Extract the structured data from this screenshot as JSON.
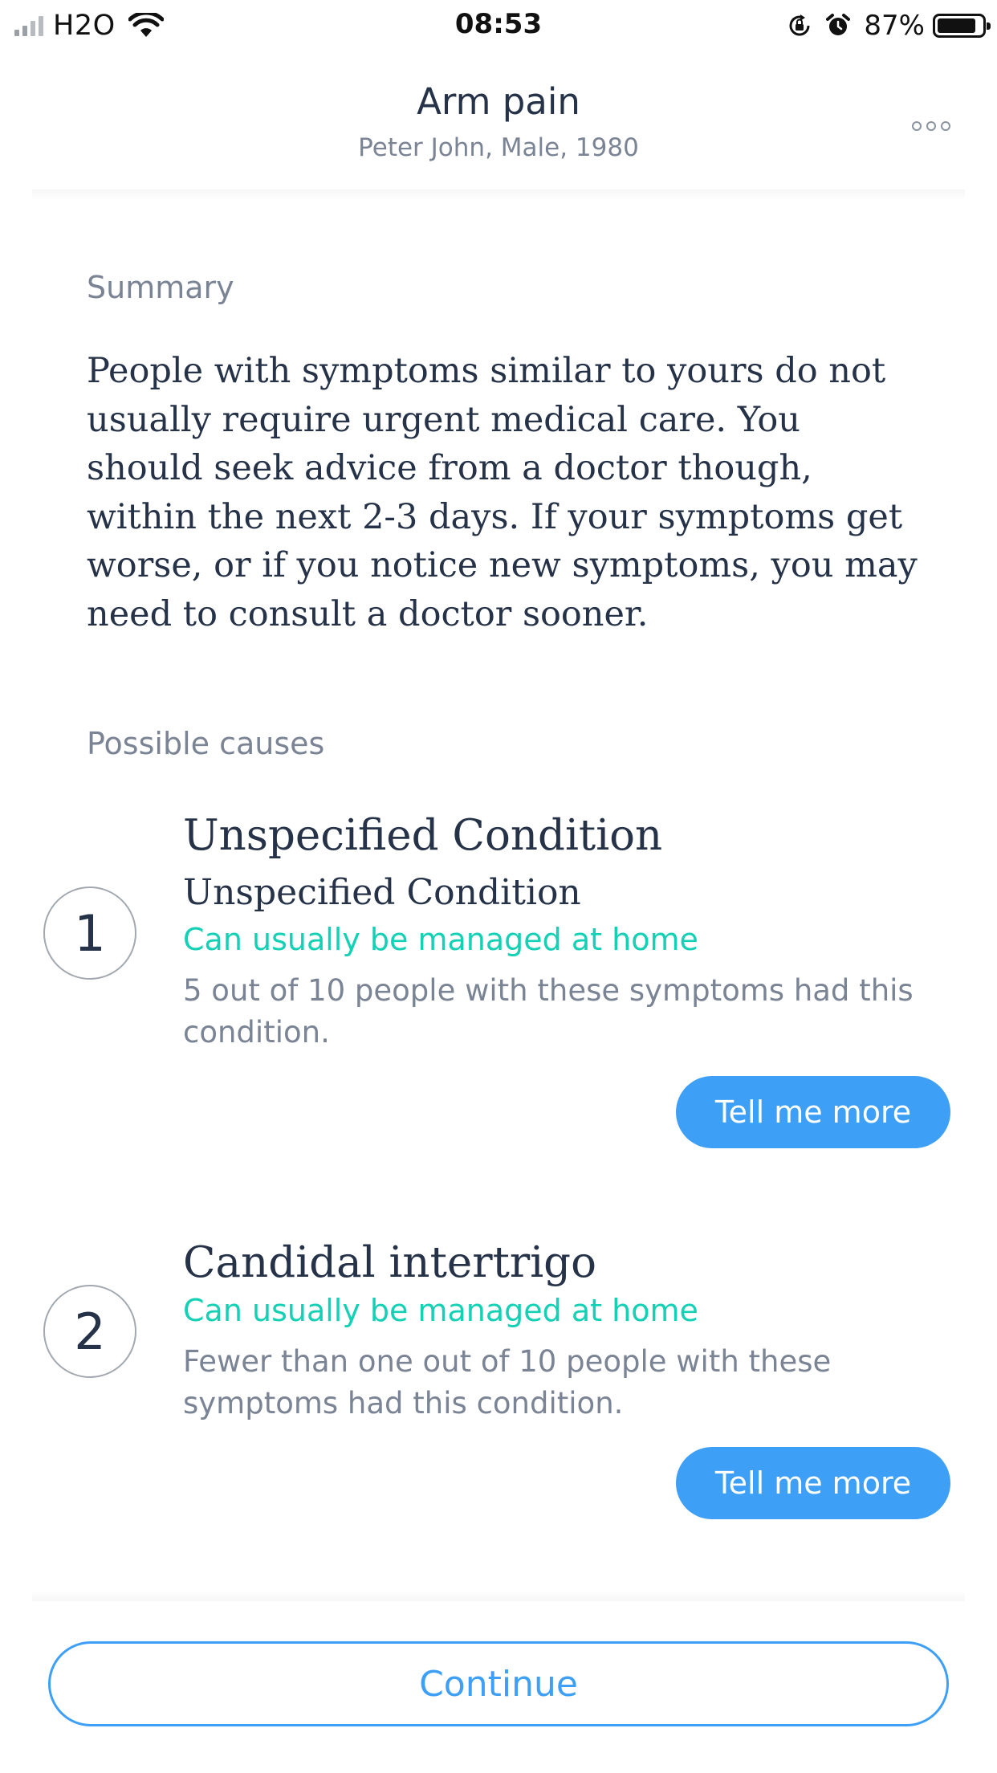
{
  "status_bar": {
    "carrier": "H2O",
    "time": "08:53",
    "battery_percent": "87%",
    "battery_level": 0.87,
    "icons": [
      "signal-icon",
      "wifi-icon",
      "rotation-lock-icon",
      "alarm-icon",
      "battery-icon"
    ]
  },
  "header": {
    "title": "Arm pain",
    "subtitle": "Peter John, Male, 1980",
    "menu_icon": "more-icon"
  },
  "summary": {
    "label": "Summary",
    "text": "People with symptoms similar to yours do not usually require urgent medical care. You should seek advice from a doctor though, within the next 2-3 days. If your symptoms get worse, or if you notice new symptoms, you may need to consult a doctor sooner."
  },
  "causes": {
    "label": "Possible causes",
    "items": [
      {
        "rank": "1",
        "title": "Unspecified Condition",
        "subtitle": "Unspecified Condition",
        "status": "Can usually be managed at home",
        "description": "5 out of 10 people with these symptoms had this condition.",
        "button_label": "Tell me more"
      },
      {
        "rank": "2",
        "title": "Candidal intertrigo",
        "status": "Can usually be managed at home",
        "description": "Fewer than one out of 10 people with these symptoms had this condition.",
        "button_label": "Tell me more"
      }
    ]
  },
  "footer": {
    "continue_label": "Continue"
  },
  "colors": {
    "accent_blue": "#3e9ff6",
    "status_teal": "#14d0b4",
    "text_dark": "#253248",
    "text_muted": "#7a8494"
  }
}
